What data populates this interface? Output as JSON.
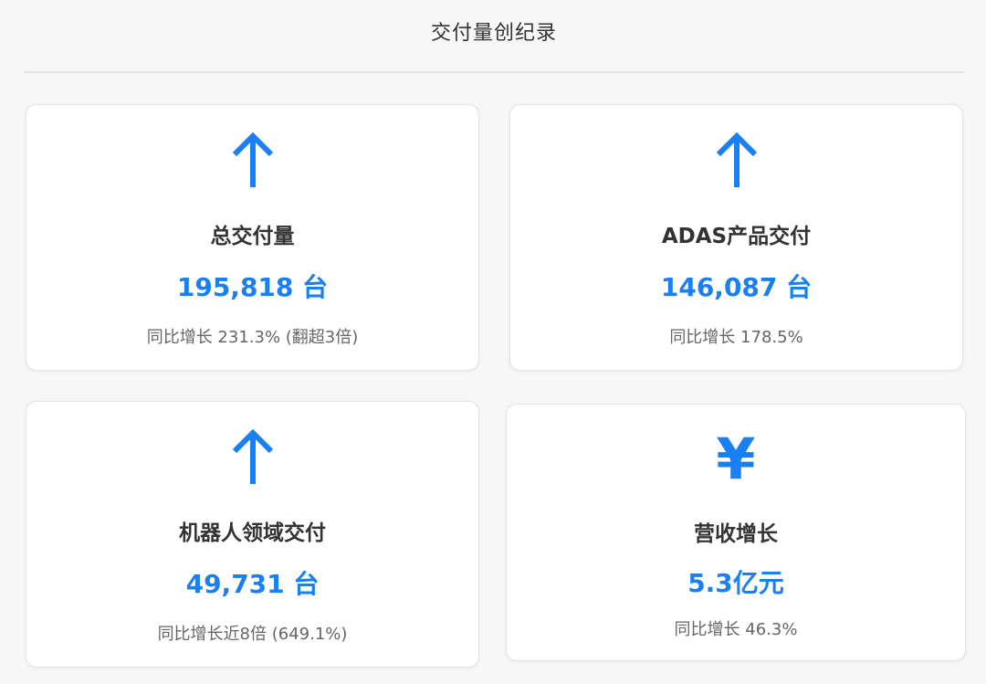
{
  "header": {
    "title": "交付量创纪录"
  },
  "cards": [
    {
      "icon": "arrow-up-icon",
      "title": "总交付量",
      "value": "195,818 台",
      "note": "同比增长 231.3% (翻超3倍)"
    },
    {
      "icon": "arrow-up-icon",
      "title": "ADAS产品交付",
      "value": "146,087 台",
      "note": "同比增长 178.5%"
    },
    {
      "icon": "arrow-up-icon",
      "title": "机器人领域交付",
      "value": "49,731 台",
      "note": "同比增长近8倍 (649.1%)"
    },
    {
      "icon": "yen-icon",
      "glyph": "¥",
      "title": "营收增长",
      "value": "5.3亿元",
      "note": "同比增长 46.3%"
    }
  ],
  "colors": {
    "accent": "#1a7ff0",
    "title": "#333333",
    "note": "#666666",
    "background": "#f7f7f7"
  }
}
